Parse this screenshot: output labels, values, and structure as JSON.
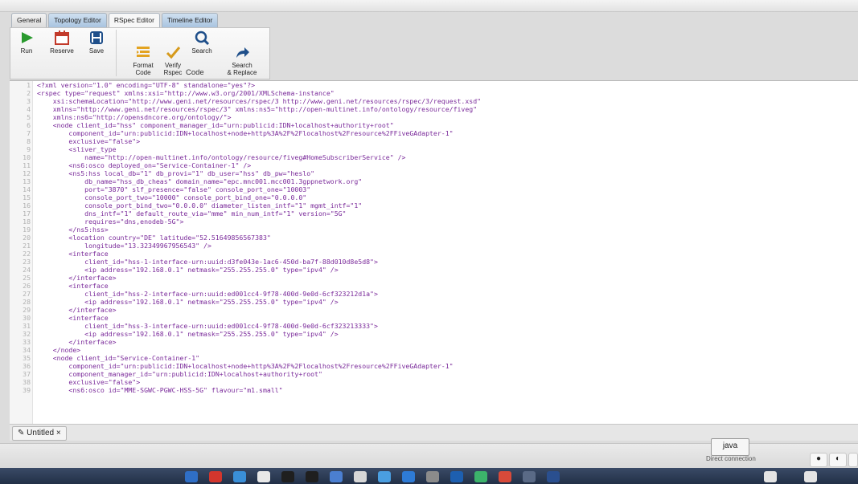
{
  "tabs": [
    "General",
    "Topology Editor",
    "RSpec Editor",
    "Timeline Editor"
  ],
  "toolbar": {
    "buttons": [
      {
        "label": "Run",
        "icon": "play-icon"
      },
      {
        "label": "Reserve",
        "icon": "calendar-icon"
      },
      {
        "label": "Save",
        "icon": "save-icon"
      },
      {
        "label": "Format\nCode",
        "icon": "format-icon"
      },
      {
        "label": "Verify\nRspec",
        "icon": "check-icon"
      },
      {
        "label": "Search",
        "icon": "search-icon"
      },
      {
        "label": "Search\n& Replace",
        "icon": "share-arrow-icon"
      }
    ],
    "group_label": "Code"
  },
  "editor": {
    "lines": [
      "<?xml version=\"1.0\" encoding=\"UTF-8\" standalone=\"yes\"?>",
      "<rspec type=\"request\" xmlns:xsi=\"http://www.w3.org/2001/XMLSchema-instance\"",
      "    xsi:schemaLocation=\"http://www.geni.net/resources/rspec/3 http://www.geni.net/resources/rspec/3/request.xsd\"",
      "    xmlns=\"http://www.geni.net/resources/rspec/3\" xmlns:ns5=\"http://open-multinet.info/ontology/resource/fiveg\"",
      "    xmlns:ns6=\"http://opensdncore.org/ontology/\">",
      "    <node client_id=\"hss\" component_manager_id=\"urn:publicid:IDN+localhost+authority+root\"",
      "        component_id=\"urn:publicid:IDN+localhost+node+http%3A%2F%2Flocalhost%2Fresource%2FFiveGAdapter-1\"",
      "        exclusive=\"false\">",
      "        <sliver_type",
      "            name=\"http://open-multinet.info/ontology/resource/fiveg#HomeSubscriberService\" />",
      "        <ns6:osco deployed_on=\"Service-Container-1\" />",
      "        <ns5:hss local_db=\"1\" db_provi=\"1\" db_user=\"hss\" db_pw=\"heslo\"",
      "            db_name=\"hss_db_cheas\" domain_name=\"epc.mnc001.mcc001.3gppnetwork.org\"",
      "            port=\"3870\" slf_presence=\"false\" console_port_one=\"10003\"",
      "            console_port_two=\"10000\" console_port_bind_one=\"0.0.0.0\"",
      "            console_port_bind_two=\"0.0.0.0\" diameter_listen_intf=\"1\" mgmt_intf=\"1\"",
      "            dns_intf=\"1\" default_route_via=\"mme\" min_num_intf=\"1\" version=\"5G\"",
      "            requires=\"dns,enodeb-5G\">",
      "        </ns5:hss>",
      "        <location country=\"DE\" latitude=\"52.51649856567383\"",
      "            longitude=\"13.32349967956543\" />",
      "        <interface",
      "            client_id=\"hss-1-interface-urn:uuid:d3fe043e-1ac6-450d-ba7f-88d010d8e5d8\">",
      "            <ip address=\"192.168.0.1\" netmask=\"255.255.255.0\" type=\"ipv4\" />",
      "        </interface>",
      "        <interface",
      "            client_id=\"hss-2-interface-urn:uuid:ed001cc4-9f78-400d-9e0d-6cf323212d1a\">",
      "            <ip address=\"192.168.0.1\" netmask=\"255.255.255.0\" type=\"ipv4\" />",
      "        </interface>",
      "        <interface",
      "            client_id=\"hss-3-interface-urn:uuid:ed001cc4-9f78-400d-9e0d-6cf323213333\">",
      "            <ip address=\"192.168.0.1\" netmask=\"255.255.255.0\" type=\"ipv4\" />",
      "        </interface>",
      "    </node>",
      "    <node client_id=\"Service-Container-1\"",
      "        component_id=\"urn:publicid:IDN+localhost+node+http%3A%2F%2Flocalhost%2Fresource%2FFiveGAdapter-1\"",
      "        component_manager_id=\"urn:publicid:IDN+localhost+authority+root\"",
      "        exclusive=\"false\">",
      "        <ns6:osco id=\"MME-SGWC-PGWC-HSS-5G\" flavour=\"m1.small\""
    ]
  },
  "document_tab": {
    "label": "Untitled",
    "close": "×"
  },
  "statusbar": {
    "tooltip": "java",
    "connection_text": "Direct connection"
  }
}
